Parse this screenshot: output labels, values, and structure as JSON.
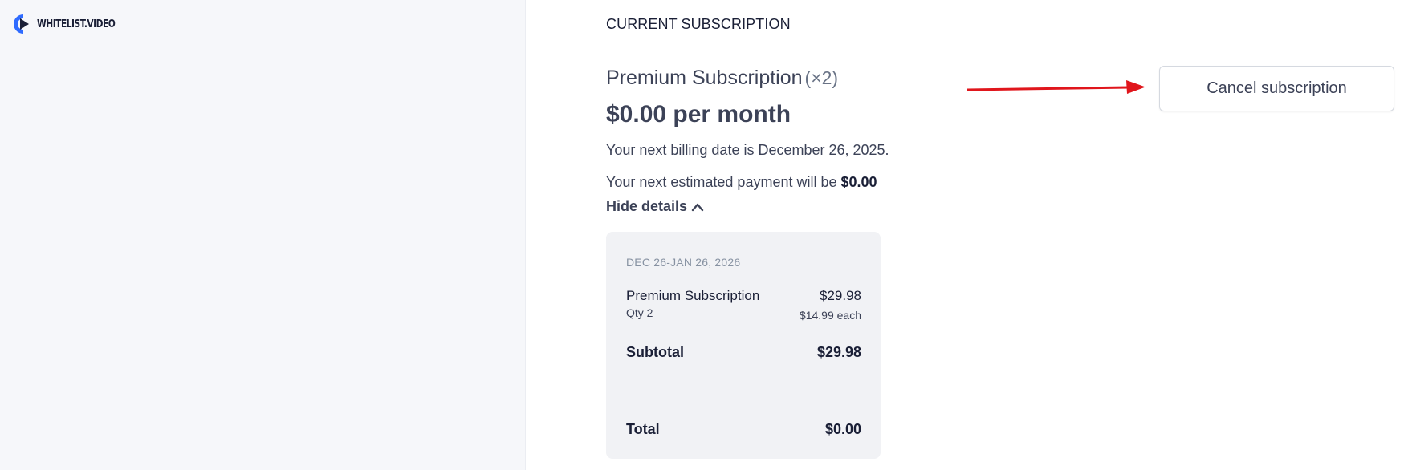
{
  "brand": {
    "name": "WHITELIST.VIDEO",
    "accent_color": "#2f6bff",
    "mark_color": "#1a1f36"
  },
  "subscription": {
    "section_title": "CURRENT SUBSCRIPTION",
    "plan_name": "Premium Subscription",
    "plan_qty": "(×2)",
    "price_text": "$0.00 per month",
    "billing_text": "Your next billing date is December 26, 2025.",
    "estimate_prefix": "Your next estimated payment will be",
    "estimate_amount": "$0.00",
    "hide_details_label": "Hide details",
    "hide_details_icon": "chevron-up-icon"
  },
  "details": {
    "period": "DEC 26-JAN 26, 2026",
    "item_name": "Premium Subscription",
    "item_qty": "Qty 2",
    "item_amount": "$29.98",
    "item_each": "$14.99 each",
    "subtotal_label": "Subtotal",
    "subtotal_value": "$29.98",
    "total_label": "Total",
    "total_value": "$0.00"
  },
  "actions": {
    "cancel_label": "Cancel subscription"
  },
  "annotation": {
    "arrow_color": "#e0161c"
  }
}
